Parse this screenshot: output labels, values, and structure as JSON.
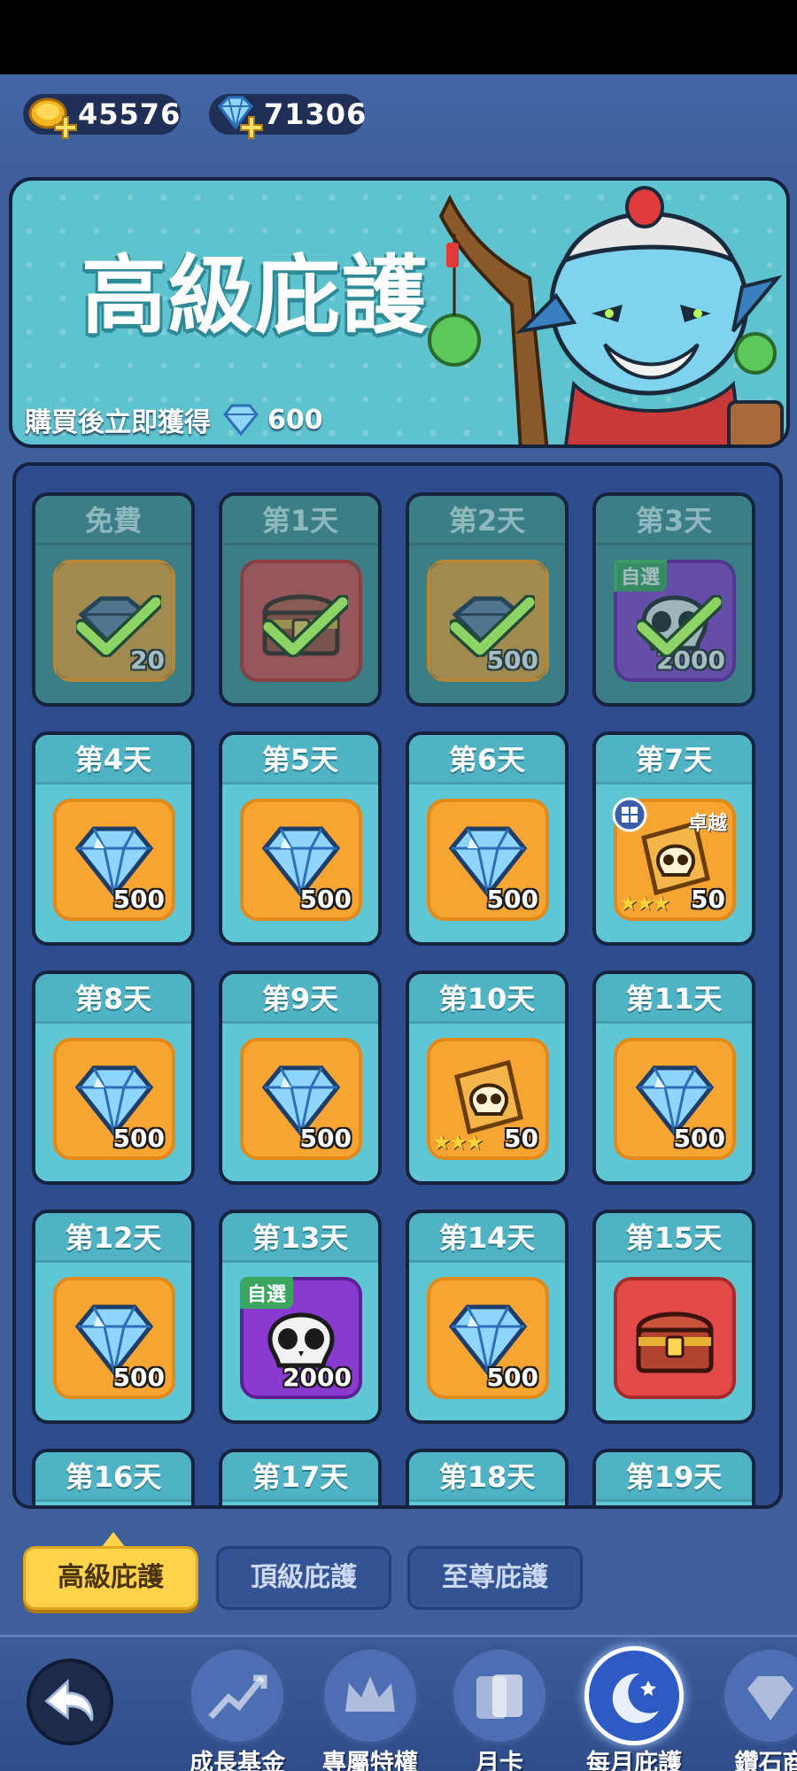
{
  "currencies": {
    "gold": {
      "amount": "45576",
      "icon": "gold-coin-icon"
    },
    "diamond": {
      "amount": "71306",
      "icon": "diamond-icon"
    }
  },
  "banner": {
    "title": "高級庇護",
    "note": "購買後立即獲得",
    "reward_amount": "600"
  },
  "rewards": [
    {
      "day": "免費",
      "item": "gem-stack-icon",
      "amount": "20",
      "claimed": true,
      "box": "orange"
    },
    {
      "day": "第1天",
      "item": "treasure-chest-icon",
      "amount": "",
      "claimed": true,
      "box": "red"
    },
    {
      "day": "第2天",
      "item": "gem-stack-icon",
      "amount": "500",
      "claimed": true,
      "box": "orange"
    },
    {
      "day": "第3天",
      "item": "skull-icon",
      "amount": "2000",
      "claimed": true,
      "box": "purple",
      "tag": "自選"
    },
    {
      "day": "第4天",
      "item": "diamond-icon",
      "amount": "500",
      "box": "orange"
    },
    {
      "day": "第5天",
      "item": "diamond-icon",
      "amount": "500",
      "box": "orange"
    },
    {
      "day": "第6天",
      "item": "diamond-icon",
      "amount": "500",
      "box": "orange"
    },
    {
      "day": "第7天",
      "item": "skull-ticket-icon",
      "amount": "50",
      "box": "orange",
      "excel": "卓越",
      "stars": "★★★"
    },
    {
      "day": "第8天",
      "item": "diamond-icon",
      "amount": "500",
      "box": "orange"
    },
    {
      "day": "第9天",
      "item": "diamond-icon",
      "amount": "500",
      "box": "orange"
    },
    {
      "day": "第10天",
      "item": "skull-ticket-icon",
      "amount": "50",
      "box": "orange",
      "stars": "★★★"
    },
    {
      "day": "第11天",
      "item": "diamond-icon",
      "amount": "500",
      "box": "orange"
    },
    {
      "day": "第12天",
      "item": "diamond-icon",
      "amount": "500",
      "box": "orange"
    },
    {
      "day": "第13天",
      "item": "skull-icon",
      "amount": "2000",
      "box": "purple",
      "tag": "自選"
    },
    {
      "day": "第14天",
      "item": "diamond-icon",
      "amount": "500",
      "box": "orange"
    },
    {
      "day": "第15天",
      "item": "treasure-chest-icon",
      "amount": "",
      "box": "red"
    },
    {
      "day": "第16天"
    },
    {
      "day": "第17天"
    },
    {
      "day": "第18天"
    },
    {
      "day": "第19天"
    }
  ],
  "tabs": [
    "高級庇護",
    "頂級庇護",
    "至尊庇護"
  ],
  "nav": [
    {
      "label": "成長基金",
      "icon": "growth-chart-icon"
    },
    {
      "label": "專屬特權",
      "icon": "crown-icon"
    },
    {
      "label": "月卡",
      "icon": "card-icon"
    },
    {
      "label": "每月庇護",
      "icon": "moon-icon"
    },
    {
      "label": "鑽石商",
      "icon": "diamond-icon"
    }
  ],
  "colors": {
    "accent": "#ffd34a",
    "panel": "#2f4c8f",
    "card": "#5ec7d3"
  }
}
